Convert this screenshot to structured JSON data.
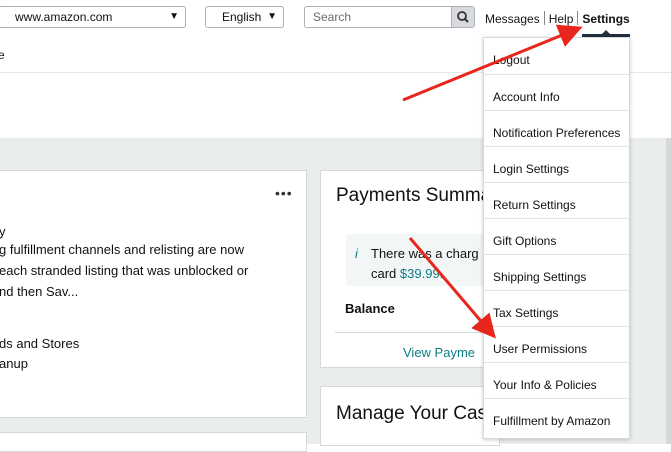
{
  "topbar": {
    "marketplace": "www.amazon.com",
    "language": "English",
    "search_placeholder": "Search",
    "messages": "Messages",
    "help": "Help",
    "settings": "Settings",
    "left_fragment": "e"
  },
  "left_card": {
    "line_link": "y",
    "line1": "g fulfillment channels and relisting are now",
    "line2": "each stranded listing that was unblocked or",
    "line3": "nd then Sav...",
    "link1": "ds and Stores",
    "link2": "anup",
    "more": "•••"
  },
  "payments": {
    "title": "Payments Summa",
    "notice_prefix": "There was a charg",
    "notice_line2_prefix": "card ",
    "notice_amount": "$39.99.",
    "balance_label": "Balance",
    "view_link": "View Payme"
  },
  "manage": {
    "title": "Manage Your Cas"
  },
  "settings_menu": {
    "items": [
      "Logout",
      "Account Info",
      "Notification Preferences",
      "Login Settings",
      "Return Settings",
      "Gift Options",
      "Shipping Settings",
      "Tax Settings",
      "User Permissions",
      "Your Info & Policies",
      "Fulfillment by Amazon"
    ]
  },
  "colors": {
    "link": "#0e7c86",
    "arrow": "#e8261c",
    "nav_dark": "#232f3e"
  }
}
